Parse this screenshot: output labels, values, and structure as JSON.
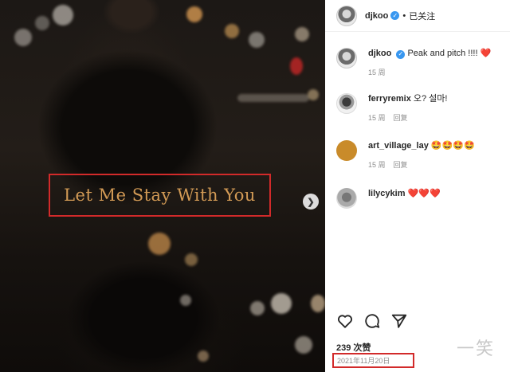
{
  "post": {
    "title_overlay": "Let Me Stay With You"
  },
  "header": {
    "username": "djkoo",
    "follow_status": "已关注",
    "separator": "•"
  },
  "comments": [
    {
      "username": "djkoo",
      "text": "Peak and pitch !!!! ❤️",
      "age": "15 周",
      "reply": ""
    },
    {
      "username": "ferryremix",
      "text": "오? 설마!",
      "age": "15 周",
      "reply": "回复"
    },
    {
      "username": "art_village_lay",
      "text": "🤩🤩🤩🤩",
      "age": "15 周",
      "reply": "回复"
    },
    {
      "username": "lilycykim",
      "text": "❤️❤️❤️",
      "age": "",
      "reply": ""
    }
  ],
  "footer": {
    "likes": "239 次赞",
    "date": "2021年11月20日"
  },
  "watermark": "一笑",
  "colors": {
    "highlight_box": "#d22a2a",
    "verified_badge": "#3897f0",
    "heart": "#ed1c24"
  },
  "icons": {
    "next": "chevron-right-icon",
    "like": "heart-outline-icon",
    "comment": "comment-bubble-icon",
    "share": "paper-plane-icon",
    "verified": "verified-badge-icon"
  }
}
